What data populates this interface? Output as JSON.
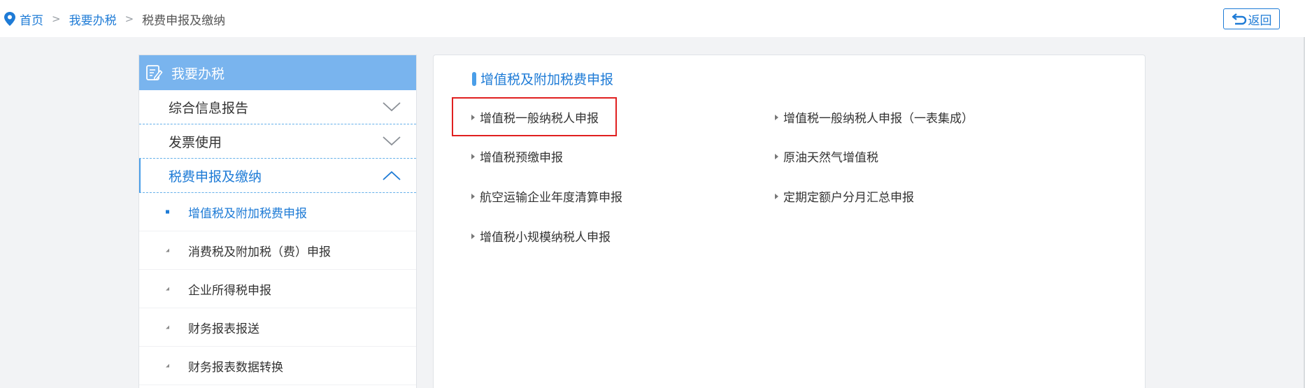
{
  "breadcrumb": {
    "home": "首页",
    "sep1": ">",
    "level2": "我要办税",
    "sep2": ">",
    "current": "税费申报及缴纳"
  },
  "back_button": {
    "label": "返回"
  },
  "sidebar": {
    "header": "我要办税",
    "groups": [
      {
        "label": "综合信息报告",
        "expanded": false
      },
      {
        "label": "发票使用",
        "expanded": false
      },
      {
        "label": "税费申报及缴纳",
        "expanded": true
      }
    ],
    "sub_items": [
      {
        "label": "增值税及附加税费申报",
        "active": true
      },
      {
        "label": "消费税及附加税（费）申报",
        "active": false
      },
      {
        "label": "企业所得税申报",
        "active": false
      },
      {
        "label": "财务报表报送",
        "active": false
      },
      {
        "label": "财务报表数据转换",
        "active": false
      }
    ]
  },
  "main": {
    "section_title": "增值税及附加税费申报",
    "links": [
      {
        "label": "增值税一般纳税人申报",
        "highlighted": true
      },
      {
        "label": "增值税一般纳税人申报（一表集成）"
      },
      {
        "label": "增值税预缴申报"
      },
      {
        "label": "原油天然气增值税"
      },
      {
        "label": "航空运输企业年度清算申报"
      },
      {
        "label": "定期定额户分月汇总申报"
      },
      {
        "label": "增值税小规模纳税人申报"
      }
    ]
  },
  "colors": {
    "accent": "#1e7bd6",
    "sidebar_header": "#79b4ee",
    "highlight": "#e02020"
  }
}
